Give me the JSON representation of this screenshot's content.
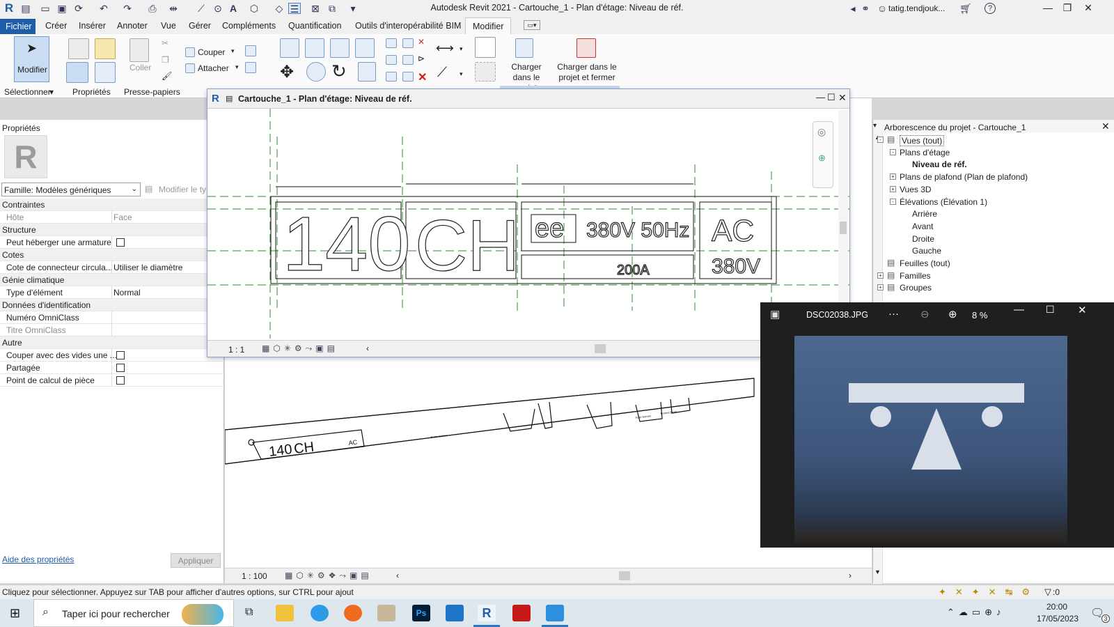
{
  "window": {
    "title": "Autodesk Revit 2021 - Cartouche_1 - Plan d'étage: Niveau de réf."
  },
  "quick_access": {
    "user": "tatig.tendjouk...",
    "help": "?"
  },
  "menu": {
    "file": "Fichier",
    "tabs": [
      "Créer",
      "Insérer",
      "Annoter",
      "Vue",
      "Gérer",
      "Compléments",
      "Quantification",
      "Outils d'interopérabilité BIM",
      "Modifier"
    ],
    "active_tab": "Modifier"
  },
  "ribbon": {
    "modify_label": "Modifier",
    "select_label": "Sélectionner",
    "properties_label": "Propriétés",
    "clipboard_label": "Presse-papiers",
    "paste_label": "Coller",
    "cut_label": "Couper",
    "join_label": "Attacher",
    "load_project": "Charger dans le projet",
    "load_project_close": "Charger dans le projet et fermer"
  },
  "properties": {
    "title": "Propriétés",
    "family": "Famille: Modèles génériques",
    "edit_type": "Modifier le ty",
    "rows": [
      {
        "type": "group",
        "k": "Contraintes"
      },
      {
        "type": "row",
        "k": "Hôte",
        "v": "Face",
        "dim": true
      },
      {
        "type": "group",
        "k": "Structure"
      },
      {
        "type": "check",
        "k": "Peut héberger une armature"
      },
      {
        "type": "group",
        "k": "Cotes"
      },
      {
        "type": "row",
        "k": "Cote de connecteur circula...",
        "v": "Utiliser le diamètre"
      },
      {
        "type": "group",
        "k": "Génie climatique"
      },
      {
        "type": "row",
        "k": "Type d'élément",
        "v": "Normal"
      },
      {
        "type": "group",
        "k": "Données d'identification"
      },
      {
        "type": "row",
        "k": "Numéro OmniClass",
        "v": ""
      },
      {
        "type": "row",
        "k": "Titre OmniClass",
        "v": "",
        "dim": true
      },
      {
        "type": "group",
        "k": "Autre"
      },
      {
        "type": "check",
        "k": "Couper avec des vides une ..."
      },
      {
        "type": "check",
        "k": "Partagée"
      },
      {
        "type": "check",
        "k": "Point de calcul de pièce"
      }
    ],
    "help_link": "Aide des propriétés",
    "apply": "Appliquer"
  },
  "view_window": {
    "title": "Cartouche_1 - Plan d'étage: Niveau de réf.",
    "scale": "1 : 1",
    "plate": {
      "power": "140",
      "unit": "CH",
      "voltage_freq": "380V 50Hz",
      "current": "200A",
      "ac": "AC",
      "ac_voltage": "380V",
      "mark": "ee"
    }
  },
  "main_view": {
    "scale": "1 : 100",
    "model_plate": {
      "power": "140",
      "unit": "CH",
      "ac": "AC",
      "small_label_1": "Sortie bornes",
      "small_label_2": "Fuite bornes",
      "small_label_3": "Bornes Essai"
    }
  },
  "project_browser": {
    "title": "Arborescence du projet - Cartouche_1",
    "items": [
      {
        "label": "Vues (tout)",
        "level": 0,
        "exp": "-",
        "icon": true
      },
      {
        "label": "Plans d'étage",
        "level": 1,
        "exp": "-"
      },
      {
        "label": "Niveau de réf.",
        "level": 2,
        "bold": true
      },
      {
        "label": "Plans de plafond (Plan de plafond)",
        "level": 1,
        "exp": "+"
      },
      {
        "label": "Vues 3D",
        "level": 1,
        "exp": "+"
      },
      {
        "label": "Élévations (Élévation 1)",
        "level": 1,
        "exp": "-"
      },
      {
        "label": "Arrière",
        "level": 2
      },
      {
        "label": "Avant",
        "level": 2
      },
      {
        "label": "Droite",
        "level": 2
      },
      {
        "label": "Gauche",
        "level": 2
      },
      {
        "label": "Feuilles (tout)",
        "level": 0,
        "icon": true
      },
      {
        "label": "Familles",
        "level": 0,
        "exp": "+",
        "icon": true
      },
      {
        "label": "Groupes",
        "level": 0,
        "exp": "+",
        "icon": true
      }
    ]
  },
  "photo_viewer": {
    "filename": "DSC02038.JPG",
    "more": "···",
    "zoom": "8 %"
  },
  "status": {
    "text": "Cliquez pour sélectionner. Appuyez sur TAB pour afficher d'autres options, sur CTRL pour ajout",
    "filter_count": ":0"
  },
  "taskbar": {
    "search": "Taper ici pour rechercher",
    "time": "20:00",
    "date": "17/05/2023",
    "notif": "3"
  },
  "colors": {
    "file_tab": "#1e5da8",
    "ref_plane": "#2e8b2e",
    "accent": "#2b74c7"
  }
}
